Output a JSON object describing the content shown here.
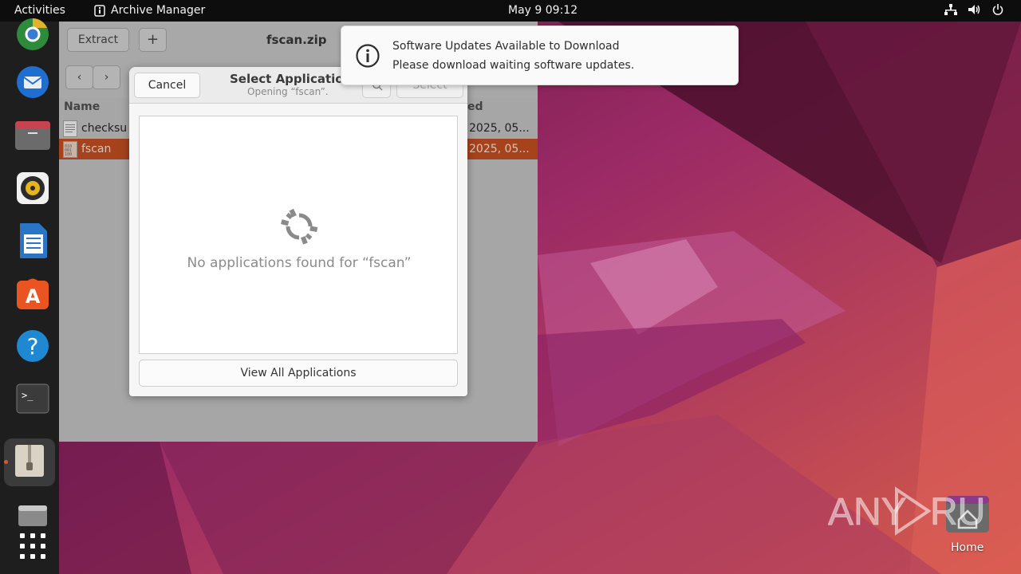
{
  "topbar": {
    "activities": "Activities",
    "app_name": "Archive Manager",
    "clock": "May 9  09:12",
    "tray_icons": [
      "network-icon",
      "volume-icon",
      "power-icon"
    ]
  },
  "dock": {
    "items": [
      "chrome",
      "thunderbird",
      "files",
      "rhythmbox",
      "libreoffice-writer",
      "app-center",
      "help",
      "terminal",
      "archive-manager",
      "removable-drive",
      "show-apps"
    ]
  },
  "archive_window": {
    "extract_label": "Extract",
    "add_label": "+",
    "title": "fscan.zip",
    "column_name": "Name",
    "column_modified_fragment": "ed",
    "files": [
      {
        "name": "checksu",
        "date": "2025, 05..."
      },
      {
        "name": "fscan",
        "date": "2025, 05..."
      }
    ]
  },
  "dialog": {
    "cancel_label": "Cancel",
    "title": "Select Applicatio",
    "subtitle": "Opening “fscan”.",
    "select_label": "Select",
    "empty_message": "No applications found for “fscan”",
    "view_all_label": "View All Applications"
  },
  "notification": {
    "title": "Software Updates Available to Download",
    "body": "Please download waiting software updates."
  },
  "desktop": {
    "home_label": "Home",
    "watermark": "ANY RUN"
  },
  "colors": {
    "accent": "#e95420",
    "selection": "#a6421c"
  }
}
